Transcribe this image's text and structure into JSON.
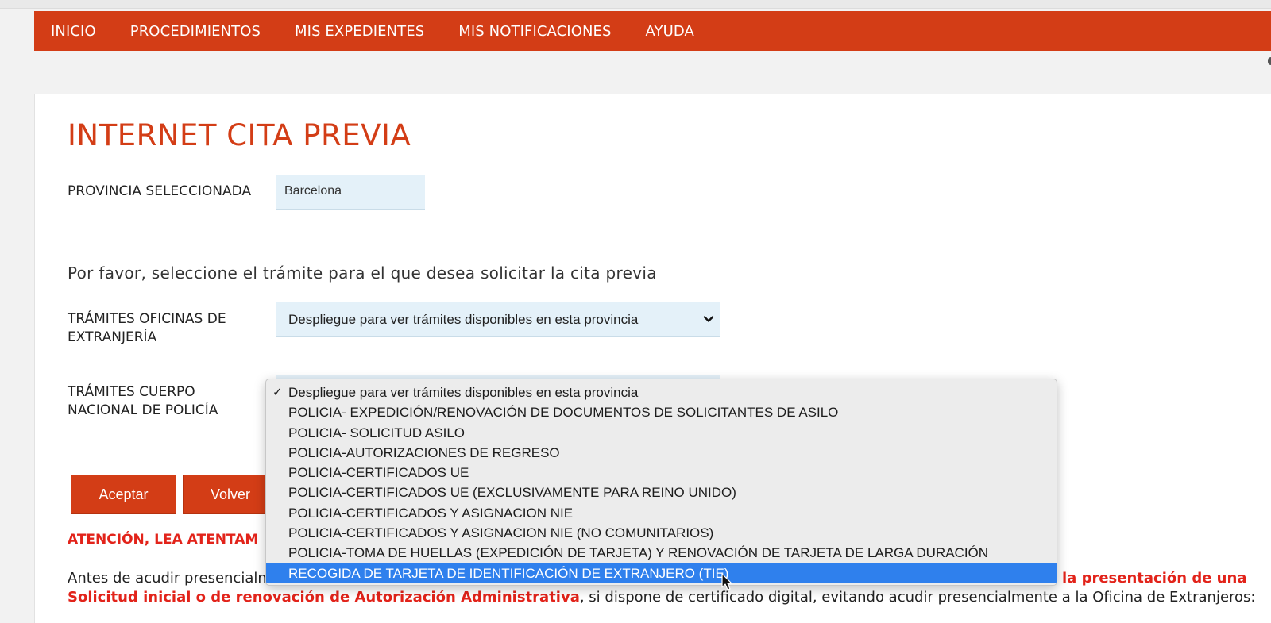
{
  "nav": {
    "items": [
      "INICIO",
      "PROCEDIMIENTOS",
      "MIS EXPEDIENTES",
      "MIS NOTIFICACIONES",
      "AYUDA"
    ]
  },
  "main": {
    "title": "INTERNET CITA PREVIA",
    "provincia_label": "PROVINCIA SELECCIONADA",
    "provincia_value": "Barcelona",
    "instruction": "Por favor, seleccione el trámite para el que desea solicitar la cita previa",
    "extranjeria_label": "TRÁMITES OFICINAS DE EXTRANJERÍA",
    "extranjeria_value": "Despliegue para ver trámites disponibles en esta provincia",
    "policia_label": "TRÁMITES CUERPO NACIONAL DE POLICÍA",
    "accept_button": "Aceptar",
    "back_button": "Volver",
    "attention_text": "ATENCIÓN, LEA ATENTAM",
    "para_line1_start": "Antes de acudir presencialm",
    "para_line1_red": "la presentación de una",
    "para_line2_red": "Solicitud inicial o de renovación de Autorización Administrativa",
    "para_line2_rest": ", si dispone de certificado digital, evitando acudir presencialmente a la Oficina de Extranjeros:"
  },
  "dropdown": {
    "checkmark": "✓",
    "options": [
      "Despliegue para ver trámites disponibles en esta provincia",
      "POLICIA- EXPEDICIÓN/RENOVACIÓN DE DOCUMENTOS DE SOLICITANTES DE ASILO",
      "POLICIA- SOLICITUD ASILO",
      "POLICIA-AUTORIZACIONES DE REGRESO",
      "POLICIA-CERTIFICADOS UE",
      "POLICIA-CERTIFICADOS UE (EXCLUSIVAMENTE PARA REINO UNIDO)",
      "POLICIA-CERTIFICADOS Y ASIGNACION NIE",
      "POLICIA-CERTIFICADOS Y ASIGNACION NIE (NO COMUNITARIOS)",
      "POLICIA-TOMA DE HUELLAS (EXPEDICIÓN DE TARJETA) Y RENOVACIÓN DE TARJETA DE LARGA DURACIÓN",
      "RECOGIDA DE TARJETA DE IDENTIFICACIÓN DE EXTRANJERO (TIE)"
    ],
    "checked_index": 0,
    "highlighted_index": 9
  },
  "colors": {
    "brand": "#d33d16",
    "field_bg": "#e4f1f9",
    "warning_red": "#e2231a",
    "highlight": "#2f80ed"
  }
}
